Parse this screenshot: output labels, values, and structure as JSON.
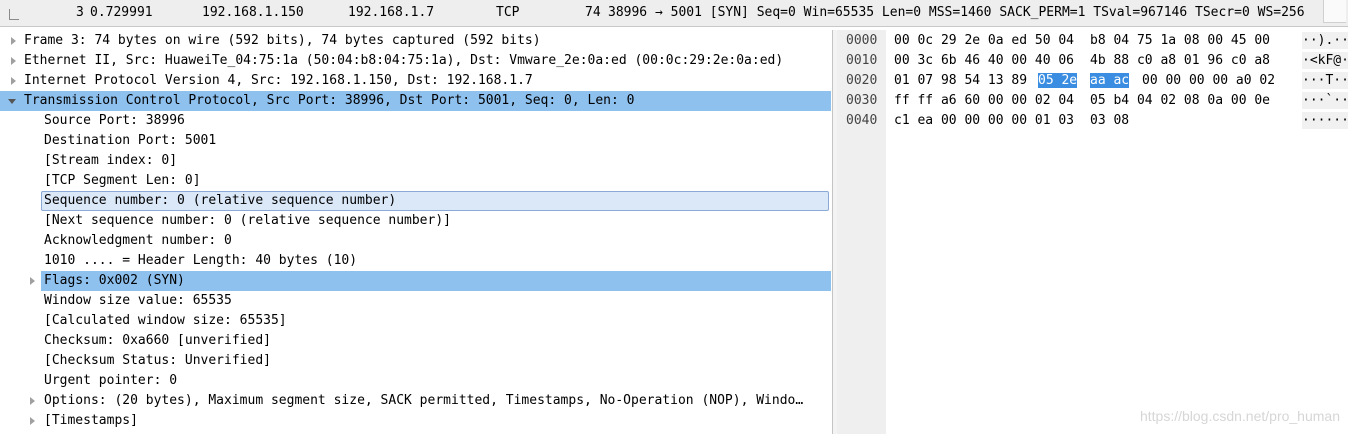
{
  "packet_list": {
    "row": {
      "no": "3",
      "time": "0.729991",
      "source": "192.168.1.150",
      "destination": "192.168.1.7",
      "protocol": "TCP",
      "length": "74",
      "info": "38996 → 5001 [SYN] Seq=0 Win=65535 Len=0 MSS=1460 SACK_PERM=1 TSval=967146 TSecr=0 WS=256"
    }
  },
  "details": {
    "frame": "Frame 3: 74 bytes on wire (592 bits), 74 bytes captured (592 bits)",
    "ethernet": "Ethernet II, Src: HuaweiTe_04:75:1a (50:04:b8:04:75:1a), Dst: Vmware_2e:0a:ed (00:0c:29:2e:0a:ed)",
    "ip": "Internet Protocol Version 4, Src: 192.168.1.150, Dst: 192.168.1.7",
    "tcp": "Transmission Control Protocol, Src Port: 38996, Dst Port: 5001, Seq: 0, Len: 0",
    "tcp_fields": {
      "src_port": "Source Port: 38996",
      "dst_port": "Destination Port: 5001",
      "stream_index": "[Stream index: 0]",
      "segment_len": "[TCP Segment Len: 0]",
      "seq": "Sequence number: 0    (relative sequence number)",
      "next_seq": "[Next sequence number: 0    (relative sequence number)]",
      "ack": "Acknowledgment number: 0",
      "header_len": "1010 .... = Header Length: 40 bytes (10)",
      "flags": "Flags: 0x002 (SYN)",
      "window": "Window size value: 65535",
      "calc_window": "[Calculated window size: 65535]",
      "checksum": "Checksum: 0xa660 [unverified]",
      "checksum_status": "[Checksum Status: Unverified]",
      "urgent": "Urgent pointer: 0",
      "options": "Options: (20 bytes), Maximum segment size, SACK permitted, Timestamps, No-Operation (NOP), Windo…",
      "timestamps": "[Timestamps]"
    }
  },
  "bytes": {
    "lines": [
      {
        "offset": "0000",
        "hex_a": "00 0c 29 2e 0a ed 50 04",
        "hex_b": "b8 04 75 1a 08 00 45 00",
        "ascii": "··).··"
      },
      {
        "offset": "0010",
        "hex_a": "00 3c 6b 46 40 00 40 06",
        "hex_b": "4b 88 c0 a8 01 96 c0 a8",
        "ascii": "·<kF@·"
      },
      {
        "offset": "0020",
        "hex_a": "01 07 98 54 13 89",
        "hl_a": "05 2e",
        "hl_b": "aa ac",
        "hex_b": "00 00 00 00 a0 02",
        "ascii": "···T··"
      },
      {
        "offset": "0030",
        "hex_a": "ff ff a6 60 00 00 02 04",
        "hex_b": "05 b4 04 02 08 0a 00 0e",
        "ascii": "···`··"
      },
      {
        "offset": "0040",
        "hex_a": "c1 ea 00 00 00 00 01 03",
        "hex_b": "03 08",
        "ascii": "······"
      }
    ]
  },
  "watermark": "https://blog.csdn.net/pro_human",
  "colors": {
    "selected_row": "#8fc1ef",
    "byte_highlight": "#3a8de0",
    "focus_row": "#dbe8f8"
  }
}
